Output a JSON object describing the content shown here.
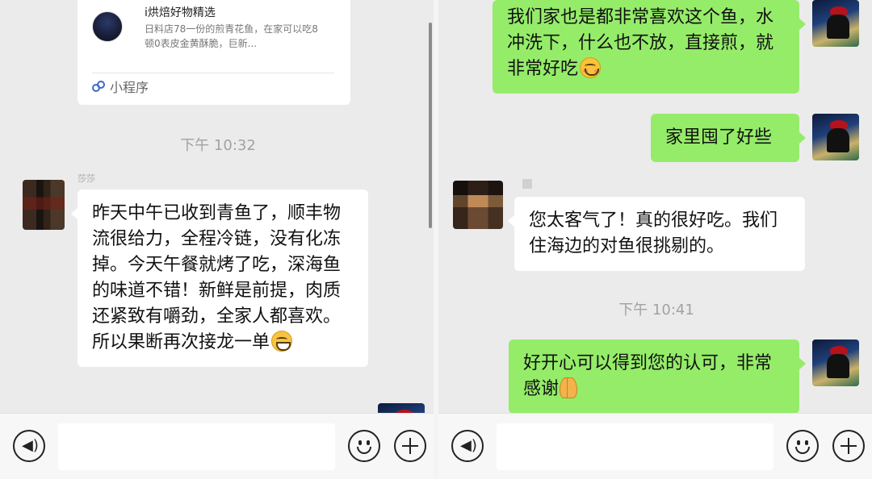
{
  "left": {
    "mini_program": {
      "title": "i烘焙好物精选",
      "desc": "日料店78一份的煎青花鱼，在家可以吃8顿0表皮金黄酥脆，巨新...",
      "footer_label": "小程序",
      "footer_icon": "mini-program-icon"
    },
    "time": "下午 10:32",
    "nickname": "莎莎",
    "message": "昨天中午已收到青鱼了，顺丰物流很给力，全程冷链，没有化冻掉。今天午餐就烤了吃，深海鱼的味道不错！新鲜是前提，肉质还紧致有嚼劲，全家人都喜欢。所以果断再次接龙一单",
    "message_emoji": "grin-emoji"
  },
  "right": {
    "msg1": "我们家也是都非常喜欢这个鱼，水冲洗下，什么也不放，直接煎，就非常好吃",
    "msg1_emoji": "smile-emoji",
    "msg2": "家里囤了好些",
    "msg3": "您太客气了！真的很好吃。我们住海边的对鱼很挑剔的。",
    "time": "下午 10:41",
    "msg4": "好开心可以得到您的认可，非常感谢",
    "msg4_emoji": "pray-emoji"
  },
  "input_bar": {
    "voice_icon": "voice-icon",
    "emoji_icon": "emoji-icon",
    "plus_icon": "plus-icon",
    "placeholder": ""
  },
  "colors": {
    "green_bubble": "#95ec69",
    "white_bubble": "#ffffff",
    "background": "#ebebeb"
  }
}
